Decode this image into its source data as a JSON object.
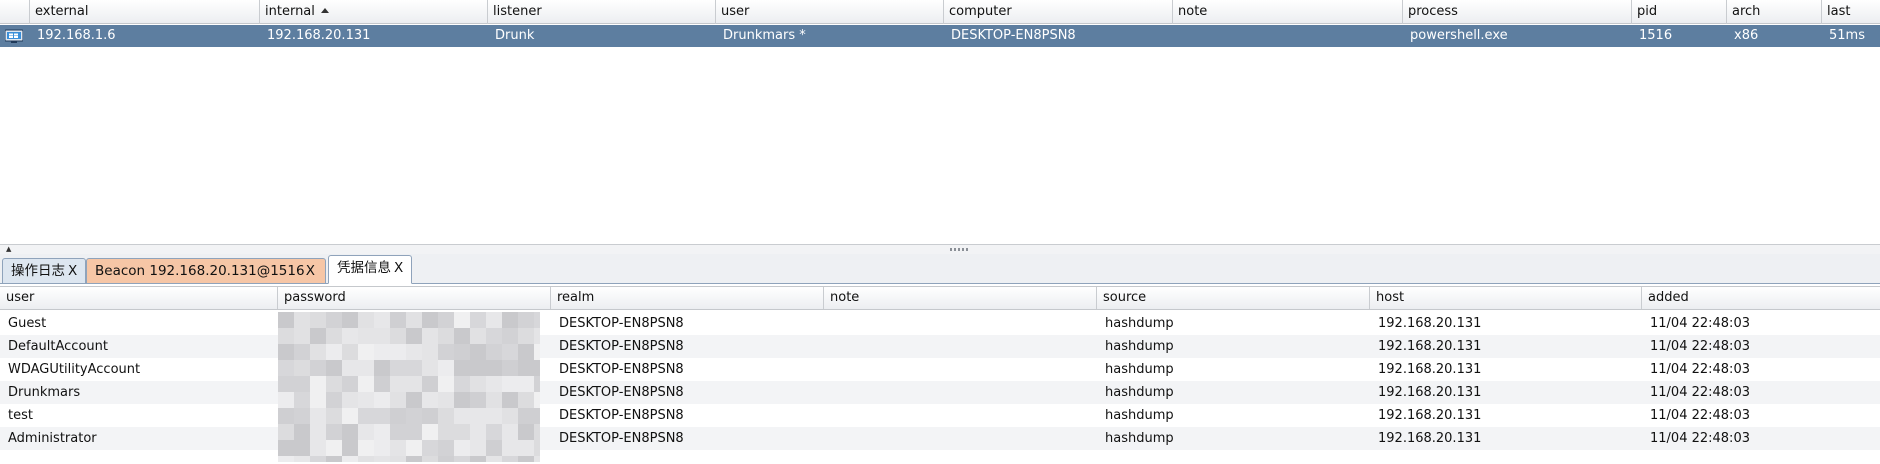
{
  "beacons": {
    "columns": [
      "",
      "external",
      "internal",
      "listener",
      "user",
      "computer",
      "note",
      "process",
      "pid",
      "arch",
      "last"
    ],
    "sorted_column": "internal",
    "sort_direction": "ascending",
    "rows": [
      {
        "icon": "windows-host-icon",
        "external": "192.168.1.6",
        "internal": "192.168.20.131",
        "listener": "Drunk",
        "user": "Drunkmars *",
        "computer": "DESKTOP-EN8PSN8",
        "note": "",
        "process": "powershell.exe",
        "pid": "1516",
        "arch": "x86",
        "last": "51ms"
      }
    ]
  },
  "tabs": [
    {
      "label": "操作日志",
      "close": "X"
    },
    {
      "label": "Beacon 192.168.20.131@1516",
      "close": "X"
    },
    {
      "label": "凭据信息",
      "close": "X"
    }
  ],
  "active_tab": 2,
  "credentials": {
    "columns": [
      "user",
      "password",
      "realm",
      "note",
      "source",
      "host",
      "added"
    ],
    "rows": [
      {
        "user": "Guest",
        "password": "",
        "realm": "DESKTOP-EN8PSN8",
        "note": "",
        "source": "hashdump",
        "host": "192.168.20.131",
        "added": "11/04 22:48:03"
      },
      {
        "user": "DefaultAccount",
        "password": "",
        "realm": "DESKTOP-EN8PSN8",
        "note": "",
        "source": "hashdump",
        "host": "192.168.20.131",
        "added": "11/04 22:48:03"
      },
      {
        "user": "WDAGUtilityAccount",
        "password": "",
        "realm": "DESKTOP-EN8PSN8",
        "note": "",
        "source": "hashdump",
        "host": "192.168.20.131",
        "added": "11/04 22:48:03"
      },
      {
        "user": "Drunkmars",
        "password": "",
        "realm": "DESKTOP-EN8PSN8",
        "note": "",
        "source": "hashdump",
        "host": "192.168.20.131",
        "added": "11/04 22:48:03"
      },
      {
        "user": "test",
        "password": "",
        "realm": "DESKTOP-EN8PSN8",
        "note": "",
        "source": "hashdump",
        "host": "192.168.20.131",
        "added": "11/04 22:48:03"
      },
      {
        "user": "Administrator",
        "password": "",
        "realm": "DESKTOP-EN8PSN8",
        "note": "",
        "source": "hashdump",
        "host": "192.168.20.131",
        "added": "11/04 22:48:03"
      }
    ],
    "password_redacted": true
  },
  "colors": {
    "selected_row": "#5d7ea0",
    "beacon_tab": "#f6c6a6",
    "log_tab": "#dde6f0"
  }
}
